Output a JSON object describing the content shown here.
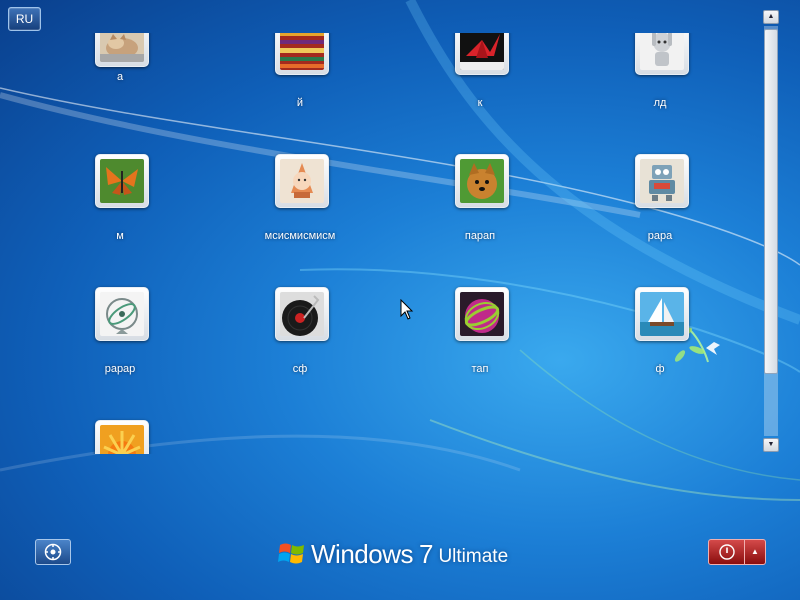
{
  "language_indicator": "RU",
  "users": [
    {
      "name": "а",
      "picture": "kitten"
    },
    {
      "name": "й",
      "picture": "striped-fabric"
    },
    {
      "name": "к",
      "picture": "origami-crane"
    },
    {
      "name": "лд",
      "picture": "robot-figure"
    },
    {
      "name": "м",
      "picture": "butterfly"
    },
    {
      "name": "мсисмисмисм",
      "picture": "doll"
    },
    {
      "name": "парап",
      "picture": "puppy"
    },
    {
      "name": "рара",
      "picture": "robot-toy"
    },
    {
      "name": "рарар",
      "picture": "gyroscope"
    },
    {
      "name": "сф",
      "picture": "vinyl-record"
    },
    {
      "name": "тап",
      "picture": "ball"
    },
    {
      "name": "ф",
      "picture": "sailboat"
    },
    {
      "name": "",
      "picture": "flower"
    }
  ],
  "branding": {
    "product": "Windows",
    "version": "7",
    "edition": "Ultimate"
  },
  "colors": {
    "background": "#1c7fd6",
    "power_button": "#b42222"
  }
}
